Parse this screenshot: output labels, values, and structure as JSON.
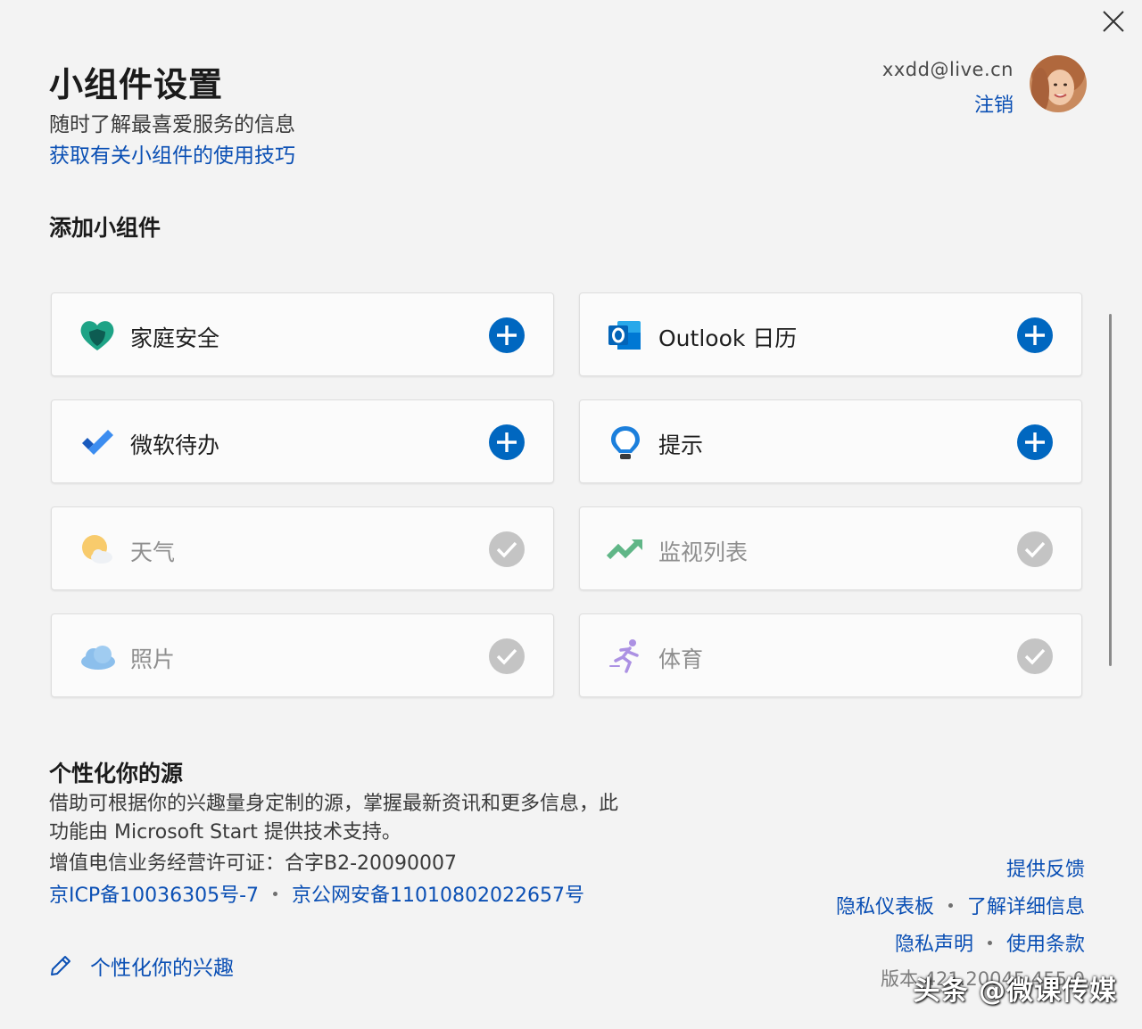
{
  "header": {
    "title": "小组件设置",
    "subtitle": "随时了解最喜爱服务的信息",
    "tips_link": "获取有关小组件的使用技巧"
  },
  "account": {
    "email": "xxdd@live.cn",
    "signout": "注销"
  },
  "add_section": {
    "title": "添加小组件",
    "widgets": [
      {
        "label": "家庭安全",
        "icon": "heart-shield-icon",
        "state": "add"
      },
      {
        "label": "Outlook 日历",
        "icon": "outlook-icon",
        "state": "add"
      },
      {
        "label": "微软待办",
        "icon": "todo-check-icon",
        "state": "add"
      },
      {
        "label": "提示",
        "icon": "lightbulb-icon",
        "state": "add"
      },
      {
        "label": "天气",
        "icon": "weather-icon",
        "state": "added"
      },
      {
        "label": "监视列表",
        "icon": "stock-chart-icon",
        "state": "added"
      },
      {
        "label": "照片",
        "icon": "cloud-icon",
        "state": "added"
      },
      {
        "label": "体育",
        "icon": "runner-icon",
        "state": "added"
      }
    ]
  },
  "personal_section": {
    "title": "个性化你的源",
    "description": "借助可根据你的兴趣量身定制的源，掌握最新资讯和更多信息，此功能由 Microsoft Start 提供技术支持。",
    "license": "增值电信业务经营许可证：合字B2-20090007",
    "icp": "京ICP备10036305号-7",
    "police": "京公网安备11010802022657号",
    "interests": "个性化你的兴趣"
  },
  "footer": {
    "feedback": "提供反馈",
    "privacy_dashboard": "隐私仪表板",
    "learn_more": "了解详细信息",
    "privacy": "隐私声明",
    "terms": "使用条款",
    "version": "版本 421.20045.455.0"
  },
  "watermark": "头条 @微课传媒",
  "colors": {
    "accent": "#0067c0",
    "link": "#0a4fb4",
    "check": "#c4c4c4"
  }
}
